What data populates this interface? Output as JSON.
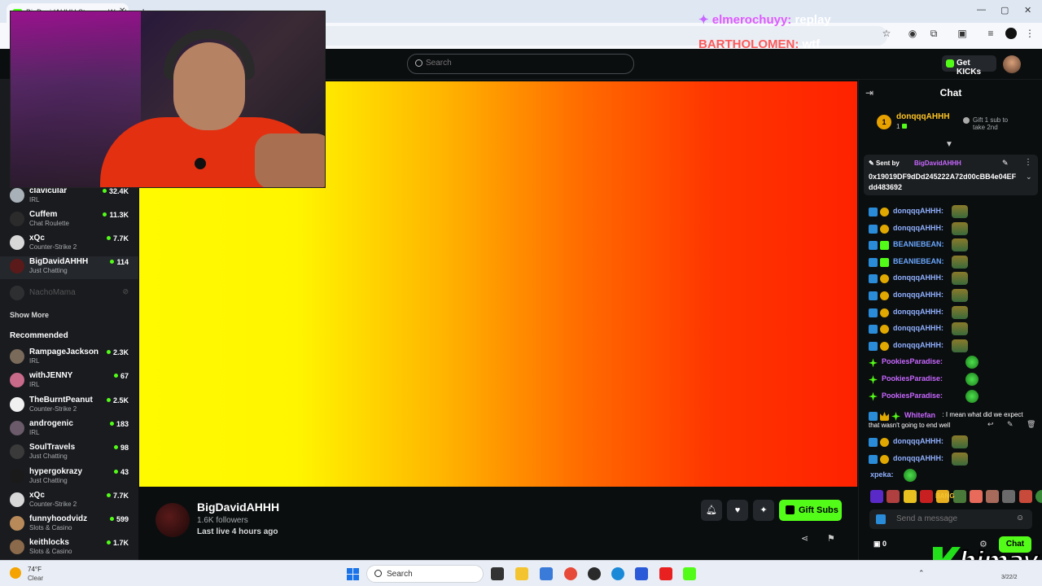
{
  "browser": {
    "tab_title": "BigDavidAHHH Stream - Watch",
    "new_tab": "+",
    "close": "✕"
  },
  "nav": {
    "search_placeholder": "Search",
    "get_kicks": "Get KICKs"
  },
  "sidebar": {
    "following": [
      {
        "name": "clavicular",
        "category": "IRL",
        "viewers": "32.4K",
        "avatar": "#a8b0b8"
      },
      {
        "name": "Cuffem",
        "category": "Chat Roulette",
        "viewers": "11.3K",
        "avatar": "#2b2b2b"
      },
      {
        "name": "xQc",
        "category": "Counter-Strike 2",
        "viewers": "7.7K",
        "avatar": "#d8d8d8"
      },
      {
        "name": "BigDavidAHHH",
        "category": "Just Chatting",
        "viewers": "114",
        "avatar": "#5a1a1a"
      }
    ],
    "offline": {
      "name": "NachoMama"
    },
    "show_more": "Show More",
    "recommended_title": "Recommended",
    "recommended": [
      {
        "name": "RampageJackson",
        "category": "IRL",
        "viewers": "2.3K",
        "avatar": "#7a6a5a"
      },
      {
        "name": "withJENNY",
        "category": "IRL",
        "viewers": "67",
        "avatar": "#c86a8a"
      },
      {
        "name": "TheBurntPeanut",
        "category": "Counter-Strike 2",
        "viewers": "2.5K",
        "avatar": "#f0f0f0"
      },
      {
        "name": "androgenic",
        "category": "IRL",
        "viewers": "183",
        "avatar": "#6a5a6a"
      },
      {
        "name": "SoulTravels",
        "category": "Just Chatting",
        "viewers": "98",
        "avatar": "#3a3a3a"
      },
      {
        "name": "hypergokrazy",
        "category": "Just Chatting",
        "viewers": "43",
        "avatar": "#1a1a1a"
      },
      {
        "name": "xQc",
        "category": "Counter-Strike 2",
        "viewers": "7.7K",
        "avatar": "#d8d8d8"
      },
      {
        "name": "funnyhoodvidz",
        "category": "Slots & Casino",
        "viewers": "599",
        "avatar": "#b88a5a"
      },
      {
        "name": "keithlocks",
        "category": "Slots & Casino",
        "viewers": "1.7K",
        "avatar": "#8a6a4a"
      }
    ]
  },
  "overlay": {
    "msg1_user": "elmerochuyy:",
    "msg1_text": "replay",
    "msg2_user": "BARTHOLOMEN:",
    "msg2_text": "wtf"
  },
  "channel": {
    "name": "BigDavidAHHH",
    "followers": "1.6K followers",
    "last_live": "Last live 4 hours ago",
    "gift_subs": "Gift Subs"
  },
  "chat": {
    "title": "Chat",
    "leader": {
      "rank_badge": "1",
      "name": "donqqqAHHH",
      "rank": "1",
      "gift_hint": "Gift 1 sub to take 2nd"
    },
    "pinned": {
      "sent_by": "Sent by",
      "user": "BigDavidAHHH",
      "text": "0x19019DF9dDd245222A72d00cBB4e04EFdd483692"
    },
    "messages": [
      {
        "user": "donqqqAHHH:",
        "color": "#8fb0ff",
        "badges": [
          "kick",
          "gold"
        ],
        "emote": "frog"
      },
      {
        "user": "donqqqAHHH:",
        "color": "#8fb0ff",
        "badges": [
          "kick",
          "gold"
        ],
        "emote": "frog"
      },
      {
        "user": "BEANIEBEAN:",
        "color": "#6aa8ff",
        "badges": [
          "kick",
          "green"
        ],
        "emote": "frog"
      },
      {
        "user": "BEANIEBEAN:",
        "color": "#6aa8ff",
        "badges": [
          "kick",
          "green"
        ],
        "emote": "frog"
      },
      {
        "user": "donqqqAHHH:",
        "color": "#8fb0ff",
        "badges": [
          "kick",
          "gold"
        ],
        "emote": "frog"
      },
      {
        "user": "donqqqAHHH:",
        "color": "#8fb0ff",
        "badges": [
          "kick",
          "gold"
        ],
        "emote": "frog"
      },
      {
        "user": "donqqqAHHH:",
        "color": "#8fb0ff",
        "badges": [
          "kick",
          "gold"
        ],
        "emote": "frog"
      },
      {
        "user": "donqqqAHHH:",
        "color": "#8fb0ff",
        "badges": [
          "kick",
          "gold"
        ],
        "emote": "frog"
      },
      {
        "user": "donqqqAHHH:",
        "color": "#8fb0ff",
        "badges": [
          "kick",
          "gold"
        ],
        "emote": "frog"
      },
      {
        "user": "PookiesParadise:",
        "color": "#c767ff",
        "badges": [
          "star"
        ],
        "emote": "green"
      },
      {
        "user": "PookiesParadise:",
        "color": "#c767ff",
        "badges": [
          "star"
        ],
        "emote": "green"
      },
      {
        "user": "PookiesParadise:",
        "color": "#c767ff",
        "badges": [
          "star"
        ],
        "emote": "green"
      }
    ],
    "whitefan": {
      "user": "Whitefan",
      "text": ": I mean what did we expect that wasn't going to end well"
    },
    "after": [
      {
        "user": "donqqqAHHH:",
        "color": "#8fb0ff",
        "badges": [
          "kick",
          "gold"
        ],
        "emote": "frog"
      },
      {
        "user": "donqqqAHHH:",
        "color": "#8fb0ff",
        "badges": [
          "kick",
          "gold"
        ],
        "emote": "frog"
      },
      {
        "user": "xpeka:",
        "color": "#8fb0ff",
        "badges": [],
        "emote": "green"
      }
    ],
    "emote_bar": [
      "#5a2ac8",
      "#b04040",
      "#e8c020",
      "#c82020",
      "#e8b020",
      "#4a7a3a",
      "#e86a5a",
      "#a86a5a",
      "#6a6a6a",
      "#c84a3a",
      "#3a8a3a"
    ],
    "emote_bang": "BANG",
    "send_placeholder": "Send a message",
    "points": "0",
    "send_label": "Chat"
  },
  "watermark": {
    "text": "himay"
  },
  "taskbar": {
    "temp": "74°F",
    "condition": "Clear",
    "search": "Search",
    "date": "3/22/2"
  }
}
